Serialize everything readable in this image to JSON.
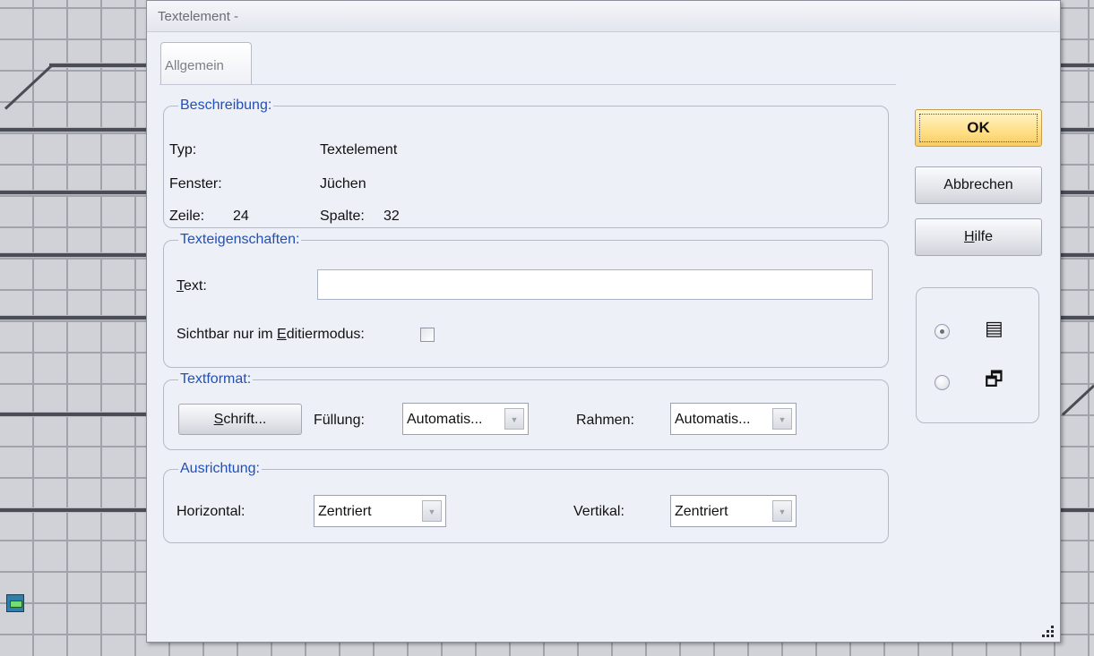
{
  "window": {
    "title": "Textelement -"
  },
  "tabs": [
    {
      "label": "Allgemein"
    }
  ],
  "beschreibung": {
    "legend": "Beschreibung:",
    "typ_label": "Typ:",
    "typ_value": "Textelement",
    "fenster_label": "Fenster:",
    "fenster_value": "Jüchen",
    "zeile_label": "Zeile:",
    "zeile_value": "24",
    "spalte_label": "Spalte:",
    "spalte_value": "32"
  },
  "texteigenschaften": {
    "legend": "Texteigenschaften:",
    "text_label_first": "T",
    "text_label_rest": "ext:",
    "text_value": "",
    "sichtbar_label_pre": "Sichtbar nur im ",
    "sichtbar_label_key": "E",
    "sichtbar_label_post": "ditiermodus:",
    "sichtbar_checked": false
  },
  "textformat": {
    "legend": "Textformat:",
    "schrift_key": "S",
    "schrift_rest": "chrift...",
    "fuellung_label": "Füllung:",
    "fuellung_value": "Automatis...",
    "rahmen_label": "Rahmen:",
    "rahmen_value": "Automatis..."
  },
  "ausrichtung": {
    "legend": "Ausrichtung:",
    "horizontal_label": "Horizontal:",
    "horizontal_value": "Zentriert",
    "vertikal_label": "Vertikal:",
    "vertikal_value": "Zentriert"
  },
  "buttons": {
    "ok": "OK",
    "abbrechen": "Abbrechen",
    "hilfe_key": "H",
    "hilfe_rest": "ilfe"
  },
  "view_mode": {
    "options": [
      {
        "icon": "list-view-icon",
        "glyph": "▤",
        "selected": true
      },
      {
        "icon": "cascade-windows-icon",
        "glyph": "🗗",
        "selected": false
      }
    ]
  }
}
